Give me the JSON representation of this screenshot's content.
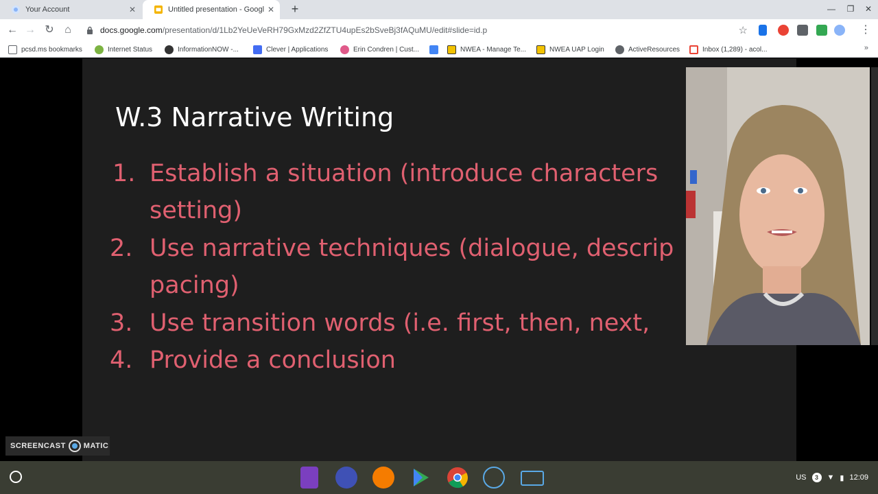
{
  "tabs": [
    {
      "title": "Your Account"
    },
    {
      "title": "Untitled presentation - Google Sl"
    }
  ],
  "toolbar": {
    "url_domain": "docs.google.com",
    "url_path": "/presentation/d/1Lb2YeUeVeRH79GxMzd2ZfZTU4upEs2bSveBj3fAQuMU/edit#slide=id.p"
  },
  "bookmarks": [
    {
      "label": "pcsd.ms bookmarks",
      "icon": "folder-icon"
    },
    {
      "label": "Internet Status",
      "icon": "status-icon"
    },
    {
      "label": "InformationNOW -...",
      "icon": "infonow-icon"
    },
    {
      "label": "Clever | Applications",
      "icon": "clever-icon"
    },
    {
      "label": "Erin Condren | Cust...",
      "icon": "erin-icon"
    },
    {
      "label": "NWEA - Manage Te...",
      "icon": "nwea-icon"
    },
    {
      "label": "NWEA UAP Login",
      "icon": "nwea-icon"
    },
    {
      "label": "ActiveResources",
      "icon": "globe-icon"
    },
    {
      "label": "Inbox (1,289) - acol...",
      "icon": "gmail-icon"
    }
  ],
  "slide": {
    "title": "W.3 Narrative Writing",
    "items": [
      {
        "num": "1.",
        "line1": "Establish a situation (introduce characters",
        "line2": "setting)"
      },
      {
        "num": "2.",
        "line1": "Use narrative techniques (dialogue, descrip",
        "line2": "pacing)"
      },
      {
        "num": "3.",
        "line1": "Use transition words (i.e. first, then, next,",
        "line2": ""
      },
      {
        "num": "4.",
        "line1": "Provide a conclusion",
        "line2": ""
      }
    ]
  },
  "screencast": {
    "left": "SCREENCAST",
    "right": "MATIC"
  },
  "shelf": {
    "ime": "US",
    "notifications": "3",
    "time": "12:09"
  },
  "colors": {
    "slide_bg": "#1e1e1e",
    "title": "#ffffff",
    "list_text": "#e06070",
    "shelf": "#3a3d33"
  }
}
